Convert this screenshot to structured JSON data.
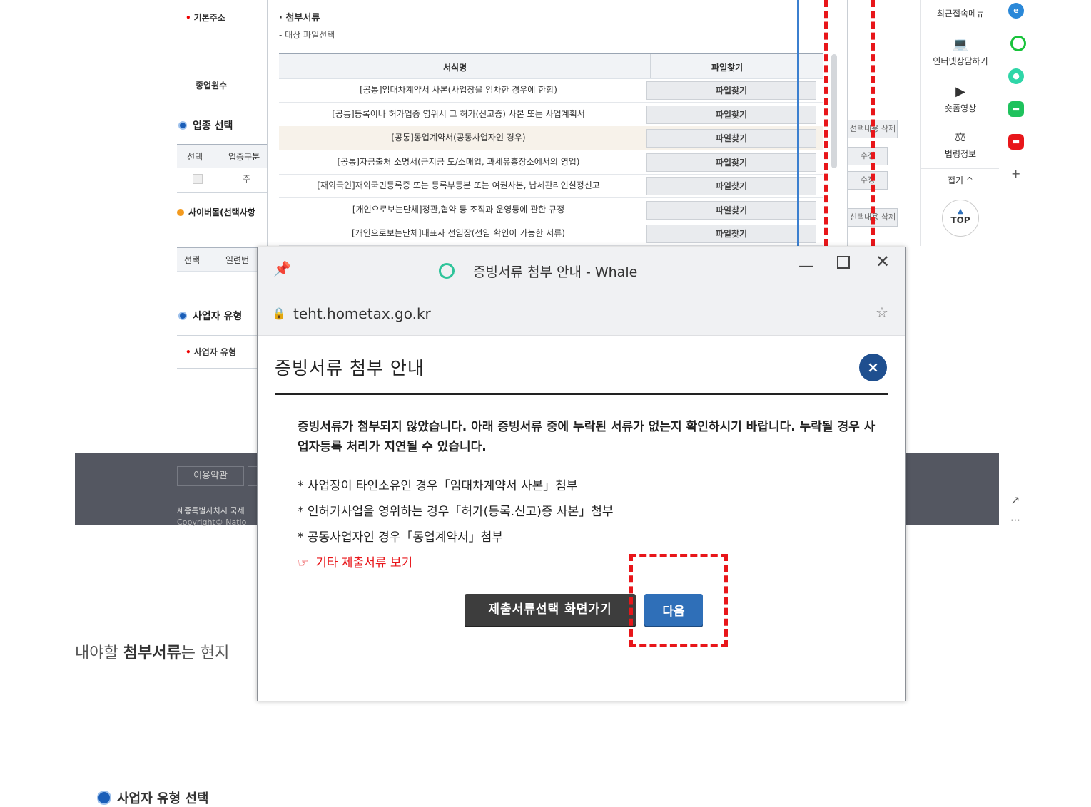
{
  "background_form": {
    "basic_address_label": "기본주소",
    "employees_label": "종업원수",
    "business_type_section": "업종 선택",
    "type_table_headers": [
      "선택",
      "업종구분"
    ],
    "type_table_row_value": "주",
    "cyber_mall_section": "사이버몰(선택사항",
    "cyber_table_headers": [
      "선택",
      "일련번"
    ],
    "operator_type_section": "사업자 유형",
    "operator_type_label": "사업자 유형",
    "edit_label": "수정",
    "delete_label": "선택내용 삭제",
    "footer_links": [
      "이용약관"
    ],
    "footer_address": "세종특별자치시 국세",
    "footer_copyright": "Copyright© Natio"
  },
  "attachment_panel": {
    "heading": "첨부서류",
    "subheading": "- 대상 파일선택",
    "col_form_name": "서식명",
    "col_file_find": "파일찾기",
    "rows": [
      {
        "name": "[공통]임대차계약서 사본(사업장을 임차한 경우에 한함)",
        "button": "파일찾기"
      },
      {
        "name": "[공통]등록이나 허가업종 영위시 그 허가(신고증) 사본 또는 사업계획서",
        "button": "파일찾기"
      },
      {
        "name": "[공통]동업계약서(공동사업자인 경우)",
        "button": "파일찾기"
      },
      {
        "name": "[공통]자금출처 소명서(금지금 도/소매업, 과세유흥장소에서의 영업)",
        "button": "파일찾기"
      },
      {
        "name": "[재외국인]재외국민등록증 또는 등록부등본 또는 여권사본, 납세관리인설정신고",
        "button": "파일찾기"
      },
      {
        "name": "[개인으로보는단체]정관,협약 등 조직과 운영등에 관한 규정",
        "button": "파일찾기"
      },
      {
        "name": "[개인으로보는단체]대표자 선임장(선임 확인이 가능한 서류)",
        "button": "파일찾기"
      }
    ]
  },
  "quick_menu": {
    "items": [
      "최근접속메뉴",
      "인터넷상담하기",
      "숏폼영상",
      "법령정보"
    ],
    "collapse": "접기 ^",
    "top": "TOP"
  },
  "dialog": {
    "window_title": "증빙서류 첨부 안내 - Whale",
    "url": "teht.hometax.go.kr",
    "title": "증빙서류 첨부 안내",
    "close_symbol": "×",
    "warning": "증빙서류가 첨부되지 않았습니다. 아래 증빙서류 중에 누락된 서류가 없는지 확인하시기 바랍니다. 누락될 경우 사업자등록 처리가 지연될 수 있습니다.",
    "bullets": [
      "* 사업장이 타인소유인 경우「임대차계약서 사본」첨부",
      "* 인허가사업을 영위하는 경우「허가(등록.신고)증 사본」첨부",
      "* 공동사업자인 경우「동업계약서」첨부"
    ],
    "other_docs_link": "기타 제출서류 보기",
    "btn_select_docs": "제출서류선택 화면가기",
    "btn_next": "다음"
  },
  "below_text": {
    "prefix": "내야할 ",
    "bold": "첨부서류",
    "suffix": "는 현지",
    "bottom_section": "사업자 유형 선택"
  },
  "colors": {
    "accent_blue": "#2f6fb8",
    "dialog_close_blue": "#1f4f8f",
    "highlight_red": "#e8161a",
    "footer_gray": "#545761"
  }
}
